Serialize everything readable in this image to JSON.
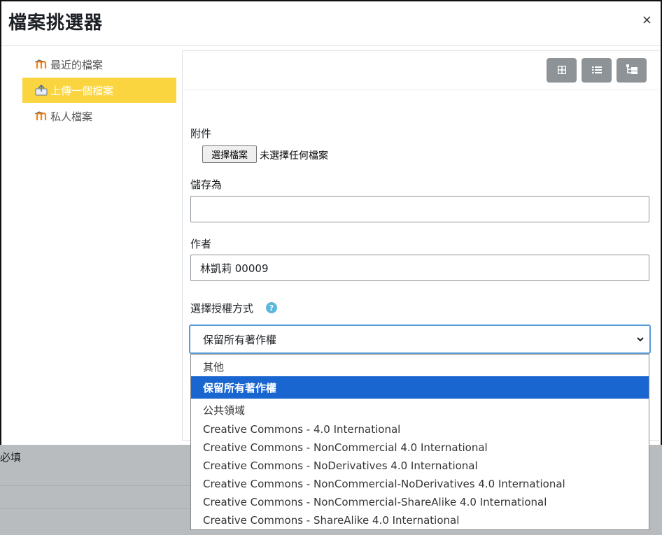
{
  "dialog": {
    "title": "檔案挑選器",
    "close_label": "×"
  },
  "sidebar": {
    "items": [
      {
        "label": "最近的檔案",
        "icon": "moodle-icon",
        "active": false
      },
      {
        "label": "上傳一個檔案",
        "icon": "upload-icon",
        "active": true
      },
      {
        "label": "私人檔案",
        "icon": "moodle-icon",
        "active": false
      }
    ]
  },
  "toolbar": {
    "views": [
      "grid-view-icon",
      "list-view-icon",
      "tree-view-icon"
    ]
  },
  "form": {
    "attachment_label": "附件",
    "choose_file_label": "選擇檔案",
    "no_file_text": "未選擇任何檔案",
    "save_as_label": "儲存為",
    "save_as_value": "",
    "author_label": "作者",
    "author_value": "林凱莉 00009",
    "license_label": "選擇授權方式",
    "license_selected": "保留所有著作權",
    "license_options": [
      "其他",
      "保留所有著作權",
      "公共領域",
      "Creative Commons - 4.0 International",
      "Creative Commons - NonCommercial 4.0 International",
      "Creative Commons - NoDerivatives 4.0 International",
      "Creative Commons - NonCommercial-NoDerivatives 4.0 International",
      "Creative Commons - NonCommercial-ShareAlike 4.0 International",
      "Creative Commons - ShareAlike 4.0 International"
    ]
  },
  "background": {
    "required_text": "必填"
  },
  "colors": {
    "accent": "#fbd53f",
    "selected_option": "#1a66d1",
    "help_icon": "#5bb7db",
    "view_button": "#8d9396"
  }
}
